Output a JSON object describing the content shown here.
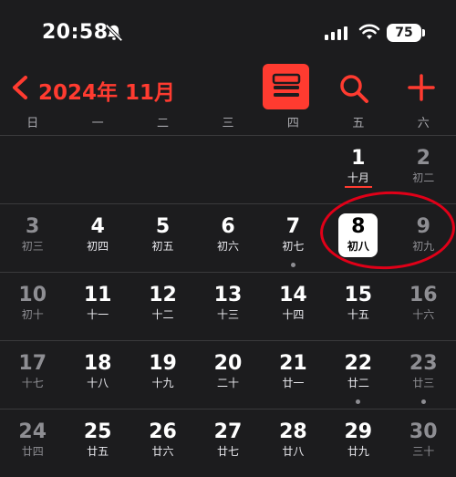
{
  "status_bar": {
    "time": "20:58",
    "battery": "75"
  },
  "nav": {
    "title": "2024年 11月"
  },
  "weekdays": [
    "日",
    "一",
    "二",
    "三",
    "四",
    "五",
    "六"
  ],
  "weeks": [
    [
      {
        "day": "",
        "lunar": ""
      },
      {
        "day": "",
        "lunar": ""
      },
      {
        "day": "",
        "lunar": ""
      },
      {
        "day": "",
        "lunar": ""
      },
      {
        "day": "",
        "lunar": ""
      },
      {
        "day": "1",
        "lunar": "十月"
      },
      {
        "day": "2",
        "lunar": "初二"
      }
    ],
    [
      {
        "day": "3",
        "lunar": "初三"
      },
      {
        "day": "4",
        "lunar": "初四"
      },
      {
        "day": "5",
        "lunar": "初五"
      },
      {
        "day": "6",
        "lunar": "初六"
      },
      {
        "day": "7",
        "lunar": "初七"
      },
      {
        "day": "8",
        "lunar": "初八"
      },
      {
        "day": "9",
        "lunar": "初九"
      }
    ],
    [
      {
        "day": "10",
        "lunar": "初十"
      },
      {
        "day": "11",
        "lunar": "十一"
      },
      {
        "day": "12",
        "lunar": "十二"
      },
      {
        "day": "13",
        "lunar": "十三"
      },
      {
        "day": "14",
        "lunar": "十四"
      },
      {
        "day": "15",
        "lunar": "十五"
      },
      {
        "day": "16",
        "lunar": "十六"
      }
    ],
    [
      {
        "day": "17",
        "lunar": "十七"
      },
      {
        "day": "18",
        "lunar": "十八"
      },
      {
        "day": "19",
        "lunar": "十九"
      },
      {
        "day": "20",
        "lunar": "二十"
      },
      {
        "day": "21",
        "lunar": "廿一"
      },
      {
        "day": "22",
        "lunar": "廿二"
      },
      {
        "day": "23",
        "lunar": "廿三"
      }
    ],
    [
      {
        "day": "24",
        "lunar": "廿四"
      },
      {
        "day": "25",
        "lunar": "廿五"
      },
      {
        "day": "26",
        "lunar": "廿六"
      },
      {
        "day": "27",
        "lunar": "廿七"
      },
      {
        "day": "28",
        "lunar": "廿八"
      },
      {
        "day": "29",
        "lunar": "廿九"
      },
      {
        "day": "30",
        "lunar": "三十"
      }
    ]
  ],
  "today": "8",
  "event_dots": [
    "7",
    "22",
    "23"
  ],
  "colors": {
    "accent": "#ff3b30",
    "background": "#1c1c1e",
    "annotation": "#e00018"
  },
  "icons": [
    "bell-slash-icon",
    "signal-icon",
    "wifi-icon",
    "battery-icon",
    "chevron-left-icon",
    "list-view-icon",
    "search-icon",
    "plus-icon"
  ]
}
